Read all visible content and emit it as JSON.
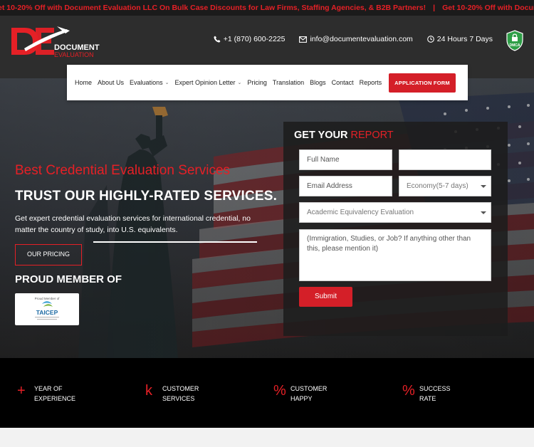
{
  "ticker": {
    "message_1": "et 10-20% Off with Document Evaluation LLC On Bulk Case Discounts for Law Firms, Staffing Agencies, & B2B Partners!",
    "separator": "|",
    "message_2": "Get 10-20% Off with Document Evaluation LLC On"
  },
  "brand": {
    "logo_text_top": "DOCUMENT",
    "logo_text_bottom": "EVALUATION",
    "logo_letters": "DE",
    "accent": "#e52026",
    "dark": "#2d2d2d"
  },
  "contacts": {
    "phone": "+1 (870) 600-2225",
    "email": "info@documentevaluation.com",
    "hours": "24 Hours 7 Days",
    "dmca_label": "DMCA"
  },
  "nav": {
    "items": [
      {
        "label": "Home",
        "has_dropdown": false
      },
      {
        "label": "About Us",
        "has_dropdown": false
      },
      {
        "label": "Evaluations",
        "has_dropdown": true
      },
      {
        "label": "Expert Opinion Letter",
        "has_dropdown": true
      },
      {
        "label": "Pricing",
        "has_dropdown": false
      },
      {
        "label": "Translation",
        "has_dropdown": false
      },
      {
        "label": "Blogs",
        "has_dropdown": false
      },
      {
        "label": "Contact",
        "has_dropdown": false
      },
      {
        "label": "Reports",
        "has_dropdown": false
      }
    ],
    "cta": "APPLICATION FORM"
  },
  "hero": {
    "eyebrow": "Best Credential Evaluation Services",
    "title": "TRUST OUR HIGHLY-RATED SERVICES.",
    "description": "Get expert credential evaluation services for international credential, no matter the country of study, into U.S. equivalents.",
    "button": "OUR PRICING",
    "member_heading": "PROUD MEMBER OF",
    "member_badge_caption": "Proud Member of",
    "member_badge_name": "TAICEP"
  },
  "form": {
    "title_white": "GET YOUR",
    "title_red": "REPORT",
    "full_name_placeholder": "Full Name",
    "second_field_value": "",
    "email_placeholder": "Email Address",
    "speed_selected": "Economy(5-7 days)",
    "evaluation_selected": "Academic Equivalency Evaluation",
    "message_placeholder": "(Immigration, Studies, or Job? If anything other than this, please mention it)",
    "submit": "Submit"
  },
  "stats": [
    {
      "symbol": "+",
      "line1": "YEAR OF",
      "line2": "EXPERIENCE"
    },
    {
      "symbol": "k",
      "line1": "CUSTOMER",
      "line2": "SERVICES"
    },
    {
      "symbol": "%",
      "line1": "CUSTOMER",
      "line2": "HAPPY"
    },
    {
      "symbol": "%",
      "line1": "SUCCESS",
      "line2": "RATE"
    }
  ]
}
